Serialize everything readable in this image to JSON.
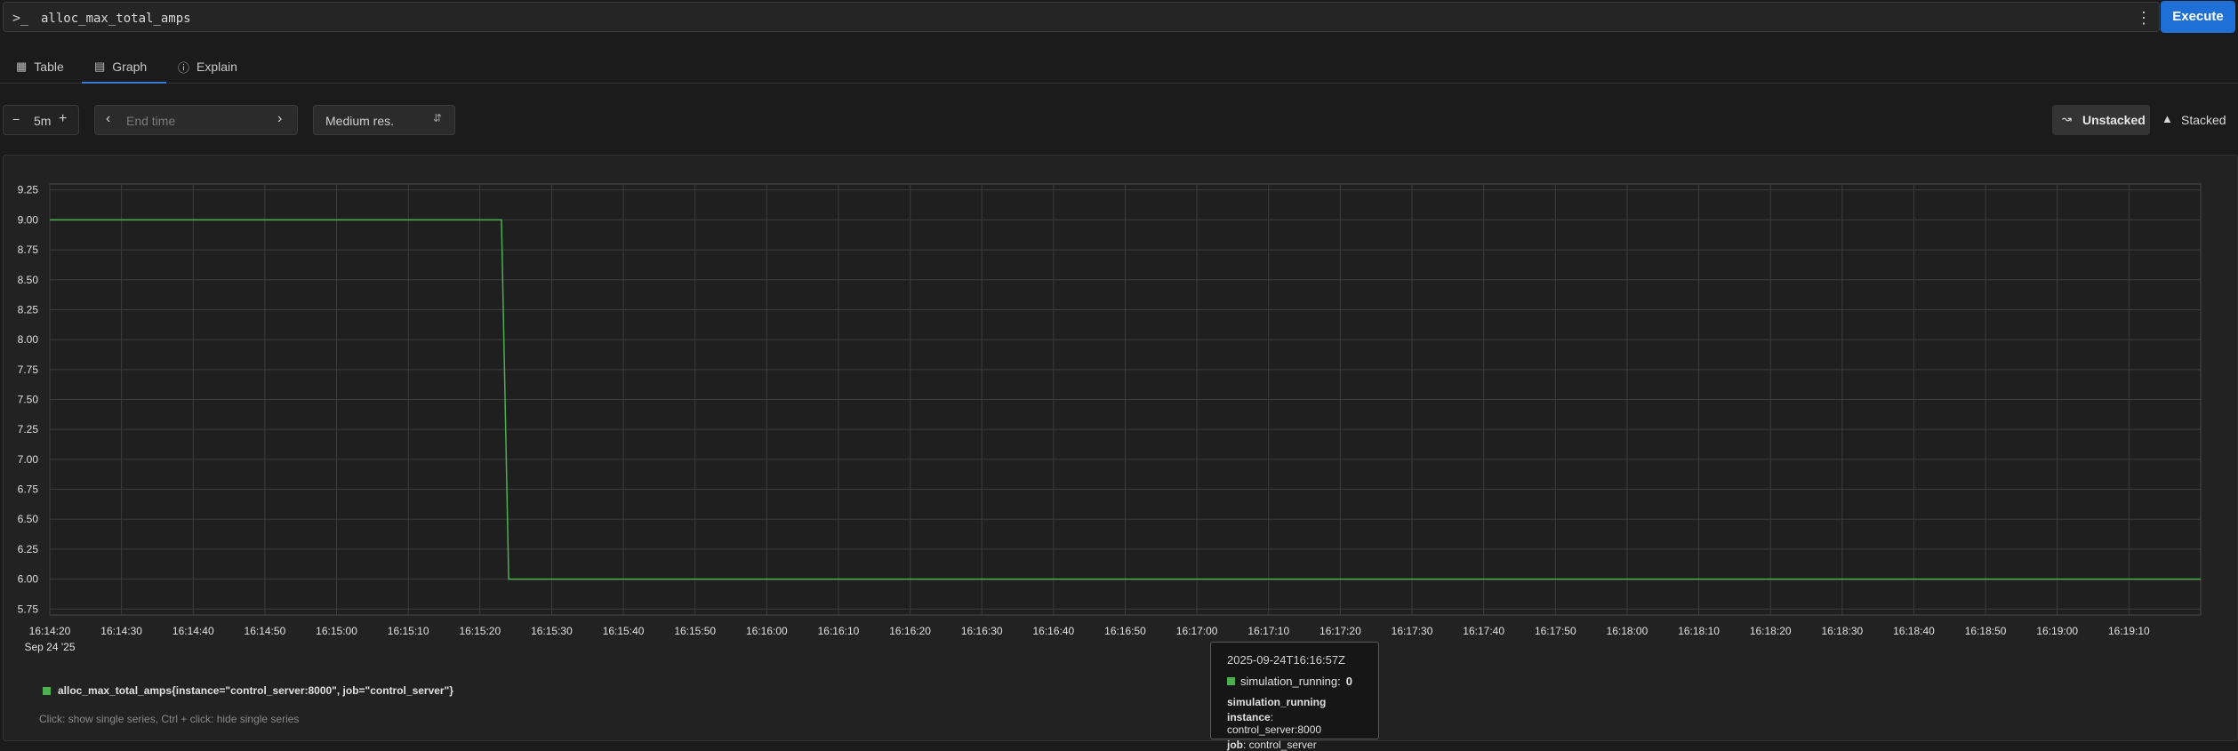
{
  "query": {
    "prompt_icon": "terminal-prompt-icon",
    "text": "alloc_max_total_amps",
    "execute_label": "Execute"
  },
  "tabs": [
    {
      "label": "Table",
      "icon": "table-icon"
    },
    {
      "label": "Graph",
      "icon": "graph-icon",
      "active": true
    },
    {
      "label": "Explain",
      "icon": "info-icon"
    }
  ],
  "controls": {
    "range_value": "5m",
    "end_time_placeholder": "End time",
    "resolution": "Medium res.",
    "unstacked_label": "Unstacked",
    "stacked_label": "Stacked"
  },
  "chart_data": {
    "type": "line",
    "y_ticks": [
      "9.25",
      "9.00",
      "8.75",
      "8.50",
      "8.25",
      "8.00",
      "7.75",
      "7.50",
      "7.25",
      "7.00",
      "6.75",
      "6.50",
      "6.25",
      "6.00",
      "5.75"
    ],
    "ylim": [
      5.7,
      9.3
    ],
    "x_ticks": [
      "16:14:20",
      "16:14:30",
      "16:14:40",
      "16:14:50",
      "16:15:00",
      "16:15:10",
      "16:15:20",
      "16:15:30",
      "16:15:40",
      "16:15:50",
      "16:16:00",
      "16:16:10",
      "16:16:20",
      "16:16:30",
      "16:16:40",
      "16:16:50",
      "16:17:00",
      "16:17:10",
      "16:17:20",
      "16:17:30",
      "16:17:40",
      "16:17:50",
      "16:18:00",
      "16:18:10",
      "16:18:20",
      "16:18:30",
      "16:18:40",
      "16:18:50",
      "16:19:00",
      "16:19:10"
    ],
    "x_date_label": "Sep 24 '25",
    "xlim": [
      "16:14:20",
      "16:19:20"
    ],
    "series": [
      {
        "name": "alloc_max_total_amps{instance=\"control_server:8000\", job=\"control_server\"}",
        "color": "#4caf50",
        "points": [
          {
            "x": "16:14:20",
            "y": 9.0
          },
          {
            "x": "16:15:23",
            "y": 9.0
          },
          {
            "x": "16:15:24",
            "y": 6.0
          },
          {
            "x": "16:19:20",
            "y": 6.0
          }
        ]
      }
    ]
  },
  "legend": {
    "label": "alloc_max_total_amps{instance=\"control_server:8000\", job=\"control_server\"}",
    "hint": "Click: show single series, Ctrl + click: hide single series"
  },
  "tooltip": {
    "timestamp": "2025-09-24T16:16:57Z",
    "series_label": "simulation_running:",
    "series_value": "0",
    "metric_name": "simulation_running",
    "instance_key": "instance",
    "instance_value": ": control_server:8000",
    "job_key": "job",
    "job_value": ": control_server"
  }
}
